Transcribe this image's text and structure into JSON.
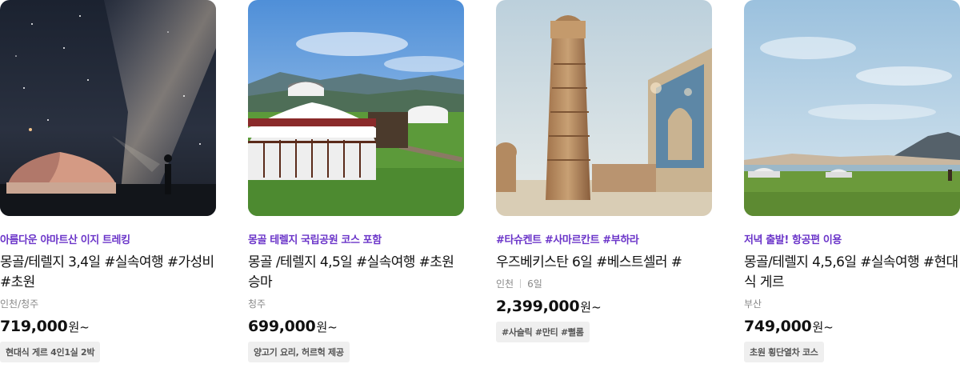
{
  "colors": {
    "promo": "#6b35c9",
    "tag_bg": "#efefef",
    "meta": "#888888"
  },
  "cards": [
    {
      "image_icon": "night-sky-yurt-photo",
      "promo": "아름다운 야마트산 이지 트레킹",
      "title": "몽골/테렐지 3,4일 #실속여행 #가성비 #초원",
      "origin": "인천/청주",
      "duration": "",
      "price": "719,000",
      "price_unit": "원~",
      "tag": "현대식 게르 4인1실 2박"
    },
    {
      "image_icon": "ger-camp-photo",
      "promo": "몽골 테렐지 국립공원 코스 포함",
      "title": "몽골 /테렐지 4,5일 #실속여행 #초원승마",
      "origin": "청주",
      "duration": "",
      "price": "699,000",
      "price_unit": "원~",
      "tag": "양고기 요리, 허르헉 제공"
    },
    {
      "image_icon": "minaret-photo",
      "promo": "#타슈켄트 #사마르칸트 #부하라",
      "title": "우즈베키스탄 6일 #베스트셀러 #",
      "origin": "인천",
      "duration": "6일",
      "price": "2,399,000",
      "price_unit": "원~",
      "tag": "#사슬릭 #만티 #뻘롬"
    },
    {
      "image_icon": "steppe-lake-photo",
      "promo": "저녁 출발! 항공편 이용",
      "title": "몽골/테렐지 4,5,6일 #실속여행 #현대식 게르",
      "origin": "부산",
      "duration": "",
      "price": "749,000",
      "price_unit": "원~",
      "tag": "초원 횡단열차 코스"
    }
  ]
}
